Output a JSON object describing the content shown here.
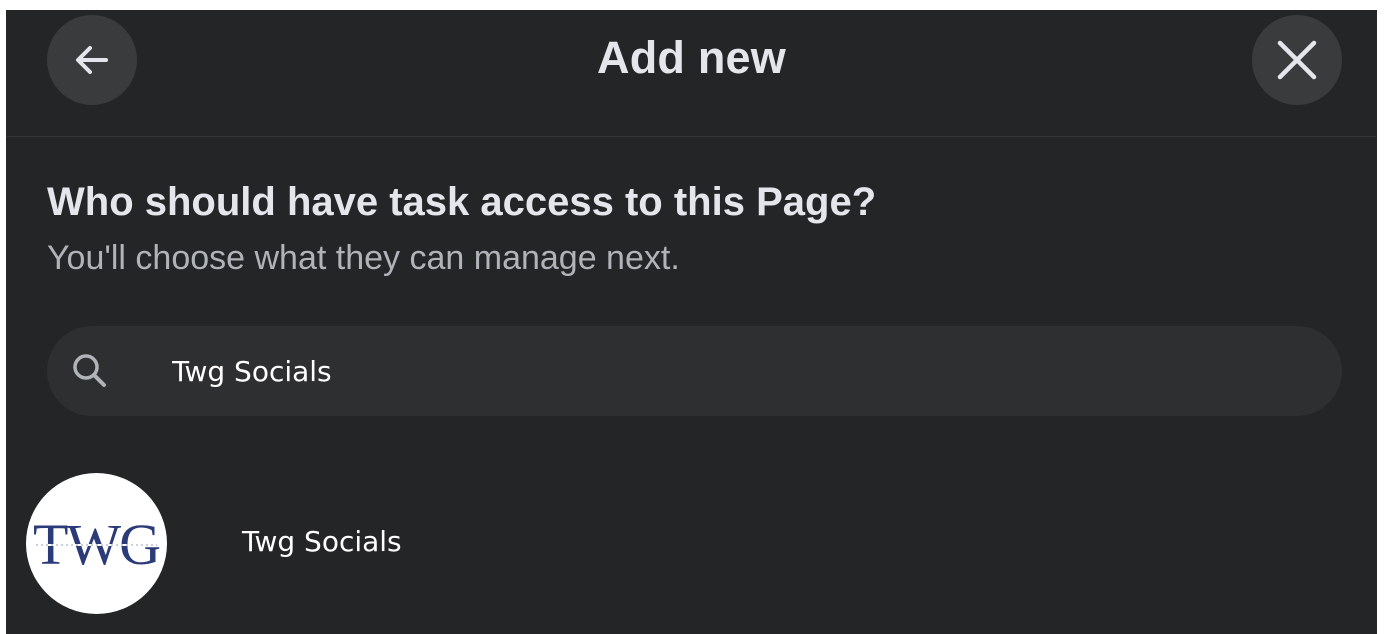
{
  "dialog": {
    "title": "Add new",
    "back_icon": "arrow-left-icon",
    "close_icon": "close-icon"
  },
  "prompt": {
    "question": "Who should have task access to this Page?",
    "subtext": "You'll choose what they can manage next."
  },
  "search": {
    "icon": "search-icon",
    "value": "Twg Socials"
  },
  "results": [
    {
      "name": "Twg Socials",
      "avatar_logo_text": "TWG"
    }
  ],
  "colors": {
    "dialog_background": "#242526",
    "button_background": "#3a3b3c",
    "search_background": "#2e2f30",
    "primary_text": "#e4e6eb",
    "secondary_text": "#b0b3b8",
    "logo_color": "#2b3a78"
  }
}
